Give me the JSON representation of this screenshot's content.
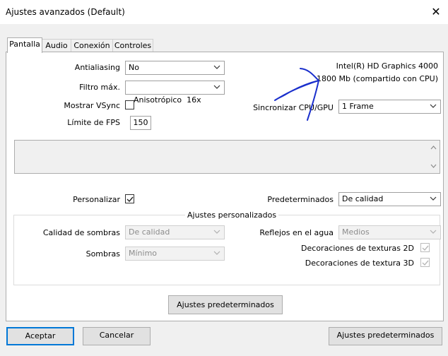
{
  "window": {
    "title": "Ajustes avanzados (Default)",
    "close_glyph": "✕"
  },
  "tabs": [
    {
      "label": "Pantalla",
      "active": true
    },
    {
      "label": "Audio",
      "active": false
    },
    {
      "label": "Conexión",
      "active": false
    },
    {
      "label": "Controles",
      "active": false
    }
  ],
  "display": {
    "antialiasing": {
      "label": "Antialiasing",
      "value": "No"
    },
    "max_filter": {
      "label": "Filtro máx.",
      "value": "Anisotrópico  16x"
    },
    "show_vsync": {
      "label": "Mostrar VSync",
      "checked": false
    },
    "fps_limit": {
      "label": "Límite de FPS",
      "value": "150"
    },
    "gpu_name": "Intel(R) HD Graphics 4000",
    "gpu_memory": "1800 Mb (compartido con CPU)",
    "sync": {
      "label": "Sincronizar CPU/GPU",
      "value": "1 Frame"
    }
  },
  "customize": {
    "label": "Personalizar",
    "checked": true
  },
  "presets": {
    "label": "Predeterminados",
    "value": "De calidad"
  },
  "custom_group": {
    "title": "Ajustes personalizados",
    "shadow_quality": {
      "label": "Calidad de sombras",
      "value": "De calidad"
    },
    "shadows": {
      "label": "Sombras",
      "value": "Mínimo"
    },
    "water_reflections": {
      "label": "Reflejos en el agua",
      "value": "Medios"
    },
    "texture_2d": {
      "label": "Decoraciones de texturas 2D",
      "checked": true
    },
    "texture_3d": {
      "label": "Decoraciones de textura 3D",
      "checked": true
    }
  },
  "buttons": {
    "panel_defaults": "Ajustes predeterminados",
    "accept": "Aceptar",
    "cancel": "Cancelar",
    "defaults": "Ajustes predeterminados"
  },
  "colors": {
    "accent": "#0078d7",
    "annotation": "#1a2fcc"
  }
}
